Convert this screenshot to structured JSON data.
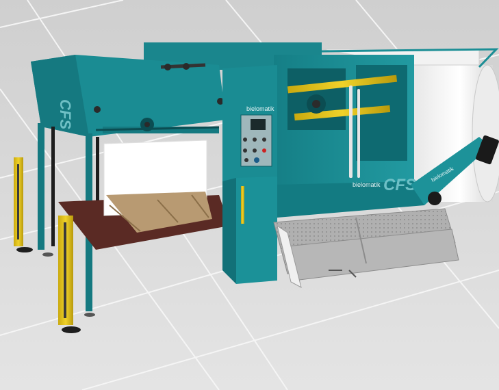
{
  "scene": {
    "brand_label": "bielomatik",
    "model_label": "CFS",
    "colors": {
      "floor": "#dcdcdc",
      "floor_grid": "#f4f4f4",
      "machine_teal": "#1c8f96",
      "machine_teal_dark": "#0f6970",
      "machine_teal_light": "#3aaab0",
      "pallet_wood": "#b89a72",
      "platform_brown": "#5a2a24",
      "light_curtain_yellow": "#e0c21a",
      "paper_white": "#f4f4f4",
      "steps_grey": "#a6a6a6"
    }
  }
}
